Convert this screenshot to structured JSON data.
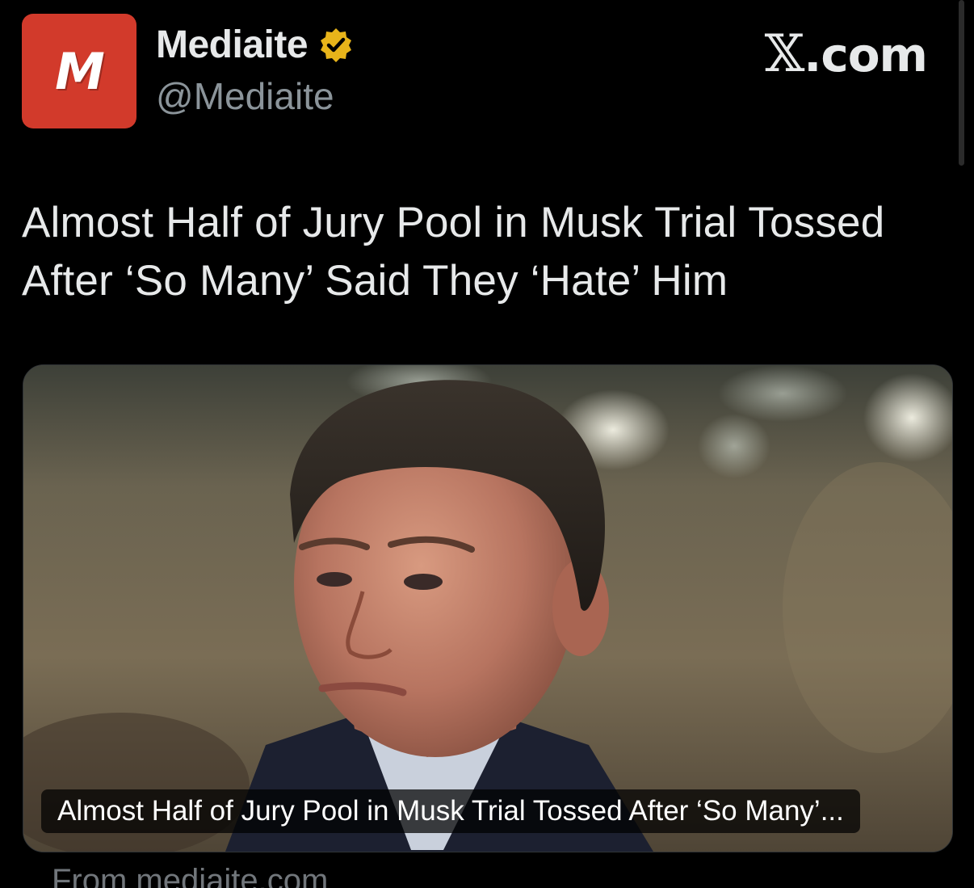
{
  "account": {
    "avatar_letter": "M",
    "display_name": "Mediaite",
    "handle": "@Mediaite",
    "verified": true
  },
  "brand": {
    "x_mark": "𝕏",
    "domain": ".com"
  },
  "post": {
    "headline": "Almost Half of Jury Pool in Musk Trial Tossed After ‘So Many’ Said They ‘Hate’ Him"
  },
  "link_card": {
    "caption": "Almost Half of Jury Pool in Musk Trial Tossed After ‘So Many’...",
    "source": "From mediaite.com"
  },
  "colors": {
    "background": "#000000",
    "avatar": "#d23a2b",
    "text_primary": "#e7e9ea",
    "text_secondary": "#8b949a",
    "verified_badge": "#e8b41a"
  }
}
